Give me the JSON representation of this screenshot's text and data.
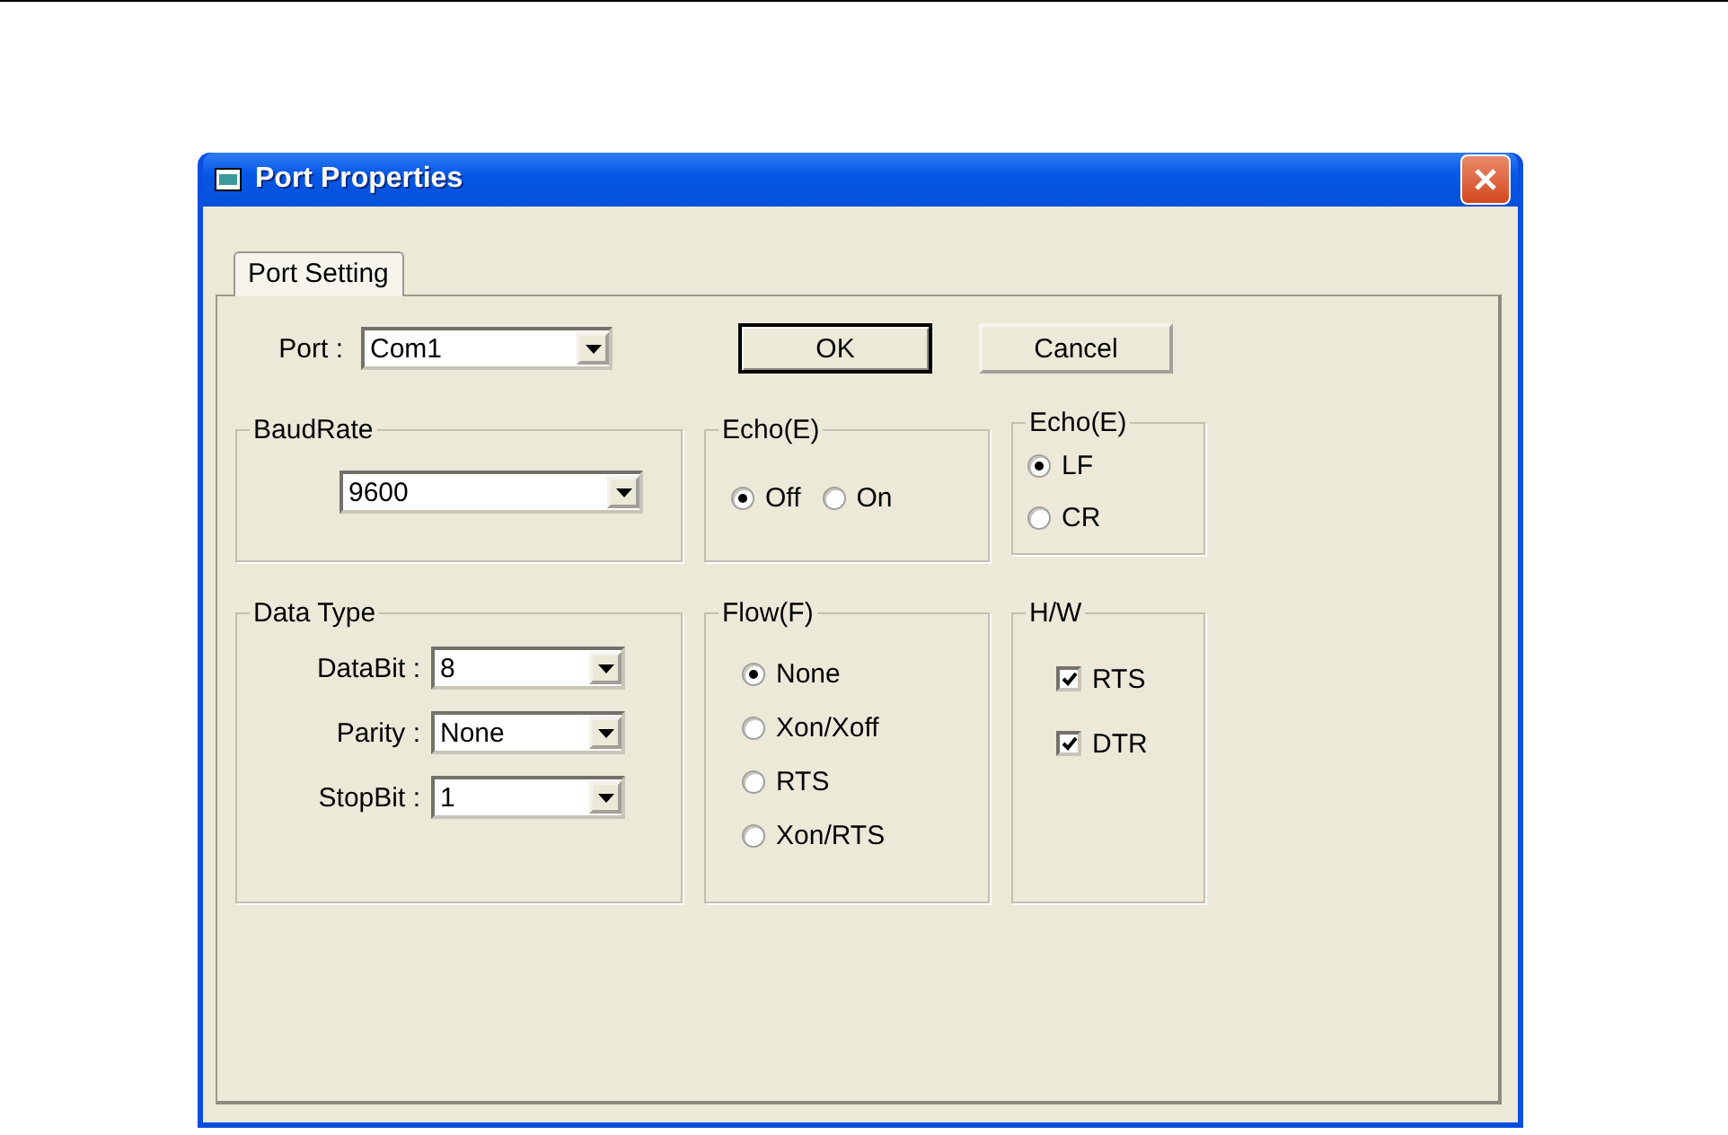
{
  "window": {
    "title": "Port Properties"
  },
  "tabs": [
    {
      "label": "Port Setting",
      "selected": true
    }
  ],
  "port": {
    "label": "Port :",
    "value": "Com1"
  },
  "buttons": [
    {
      "label": "OK",
      "default": true
    },
    {
      "label": "Cancel",
      "default": false
    }
  ],
  "baud_rate": {
    "title": "BaudRate",
    "value": "9600"
  },
  "echo": {
    "title": "Echo(E)",
    "options": [
      {
        "label": "Off",
        "selected": true
      },
      {
        "label": "On",
        "selected": false
      }
    ]
  },
  "echo_line_end": {
    "title": "Echo(E)",
    "options": [
      {
        "label": "LF",
        "selected": true
      },
      {
        "label": "CR",
        "selected": false
      }
    ]
  },
  "data_type": {
    "title": "Data Type",
    "fields": [
      {
        "label": "DataBit :",
        "value": "8"
      },
      {
        "label": "Parity :",
        "value": "None"
      },
      {
        "label": "StopBit :",
        "value": "1"
      }
    ]
  },
  "flow": {
    "title": "Flow(F)",
    "options": [
      {
        "label": "None",
        "selected": true
      },
      {
        "label": "Xon/Xoff",
        "selected": false
      },
      {
        "label": "RTS",
        "selected": false
      },
      {
        "label": "Xon/RTS",
        "selected": false
      }
    ]
  },
  "hw": {
    "title": "H/W",
    "options": [
      {
        "label": "RTS",
        "checked": true
      },
      {
        "label": "DTR",
        "checked": true
      }
    ]
  }
}
